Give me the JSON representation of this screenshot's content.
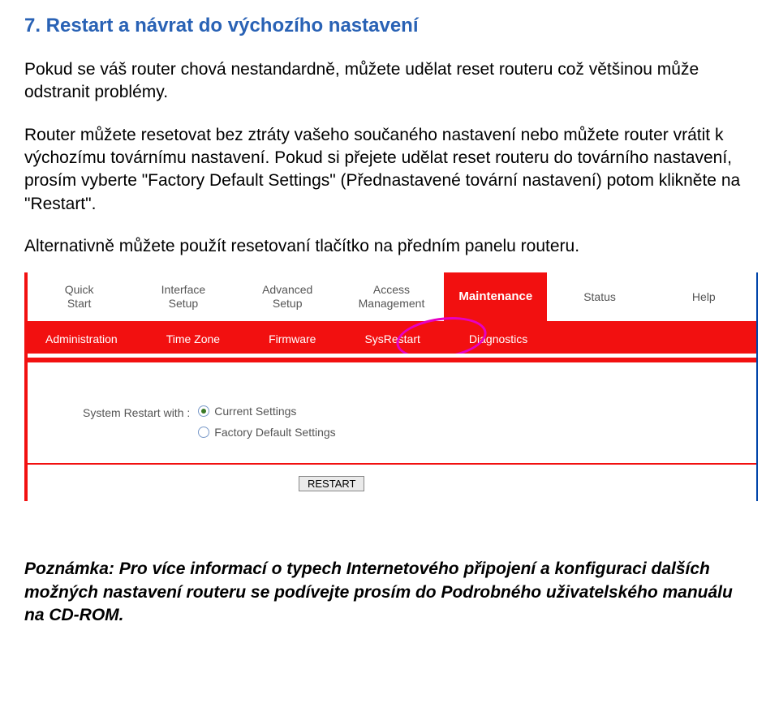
{
  "heading": "7.  Restart a návrat do výchozího nastavení",
  "paragraphs": {
    "p1": "Pokud se váš router chová nestandardně, můžete udělat reset routeru což většinou může odstranit problémy.",
    "p2": "Router můžete resetovat bez ztráty vašeho součaného nastavení nebo můžete router vrátit k výchozímu továrnímu nastavení. Pokud si přejete udělat reset routeru do továrního nastavení, prosím vyberte \"Factory Default Settings\" (Přednastavené tovární nastavení) potom klikněte na \"Restart\".",
    "p3": "Alternativně můžete použít resetovaní tlačítko na předním panelu routeru."
  },
  "tabs": {
    "t0a": "Quick",
    "t0b": "Start",
    "t1a": "Interface",
    "t1b": "Setup",
    "t2a": "Advanced",
    "t2b": "Setup",
    "t3a": "Access",
    "t3b": "Management",
    "t4": "Maintenance",
    "t5": "Status",
    "t6": "Help"
  },
  "subtabs": {
    "s0": "Administration",
    "s1": "Time Zone",
    "s2": "Firmware",
    "s3": "SysRestart",
    "s4": "Diagnostics"
  },
  "form": {
    "label": "System Restart with :",
    "opt_current": "Current Settings",
    "opt_factory": "Factory Default Settings",
    "button": "RESTART"
  },
  "note": "Poznámka: Pro více informací o typech Internetového připojení a konfiguraci dalších možných nastavení routeru se podívejte prosím do Podrobného uživatelského manuálu na CD-ROM."
}
